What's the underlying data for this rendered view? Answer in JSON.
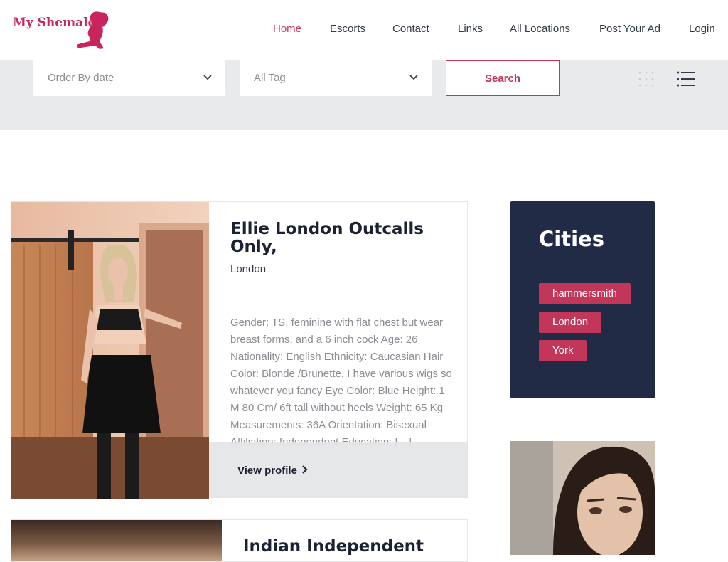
{
  "brand": {
    "logo_text": "My Shemale",
    "accent": "#c2365a",
    "dark": "#222b45"
  },
  "nav": {
    "items": [
      {
        "label": "Home",
        "active": true
      },
      {
        "label": "Escorts"
      },
      {
        "label": "Contact"
      },
      {
        "label": "Links"
      },
      {
        "label": "All Locations"
      },
      {
        "label": "Post Your Ad"
      },
      {
        "label": "Login"
      }
    ]
  },
  "filters": {
    "order_by": "Order By date",
    "tag": "All Tag",
    "search_label": "Search",
    "view_icons": [
      "grid-view-icon",
      "list-view-icon"
    ]
  },
  "listing": {
    "title": "Ellie London Outcalls Only,",
    "city": "London",
    "description": "Gender: TS, feminine with flat chest but wear breast forms, and a 6 inch cock Age: 26 Nationality: English Ethnicity: Caucasian Hair Color: Blonde /Brunette, I have various wigs so whatever you fancy Eye Color: Blue Height: 1 M 80 Cm/ 6ft tall without heels Weight: 65 Kg Measurements: 36A Orientation: Bisexual Affiliation: Independent Education: […]",
    "view_profile": "View profile"
  },
  "listing2": {
    "title": "Indian Independent"
  },
  "sidebar": {
    "cities_title": "Cities",
    "cities": [
      "hammersmith",
      "London",
      "York"
    ]
  }
}
